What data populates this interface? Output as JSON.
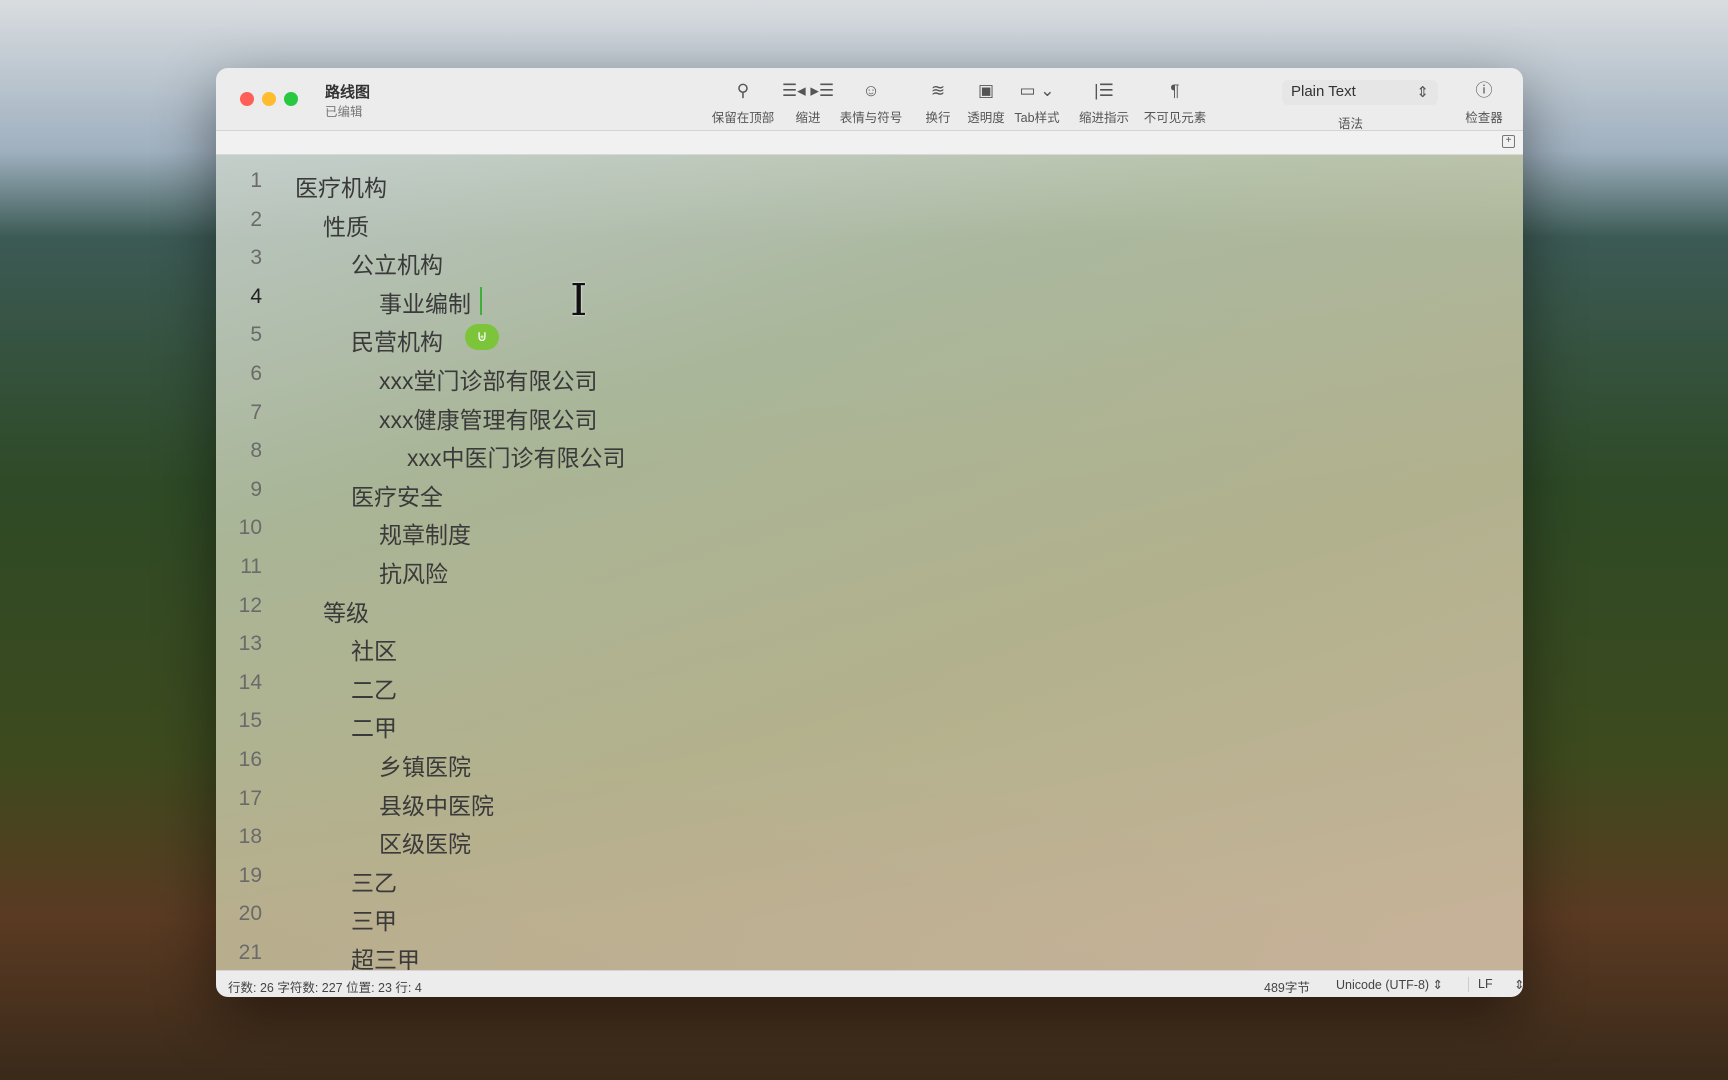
{
  "window": {
    "title": "路线图",
    "subtitle": "已编辑"
  },
  "toolbar": [
    {
      "label": "保留在顶部",
      "icon": "pin-icon",
      "glyph": "⚲"
    },
    {
      "label": "缩进",
      "icon": "indent-icon",
      "glyph": "☰◂ ▸☰"
    },
    {
      "label": "表情与符号",
      "icon": "emoji-icon",
      "glyph": "☺"
    },
    {
      "label": "换行",
      "icon": "wrap-icon",
      "glyph": "≋"
    },
    {
      "label": "透明度",
      "icon": "opacity-icon",
      "glyph": "▣"
    },
    {
      "label": "Tab样式",
      "icon": "tab-style-icon",
      "glyph": "▭ ⌄"
    },
    {
      "label": "缩进指示",
      "icon": "indent-guide-icon",
      "glyph": "|☰"
    },
    {
      "label": "不可见元素",
      "icon": "pilcrow-icon",
      "glyph": "¶"
    },
    {
      "label": "检查器",
      "icon": "info-icon",
      "glyph": "ⓘ"
    }
  ],
  "syntax": {
    "label": "语法",
    "value": "Plain Text"
  },
  "lines": [
    {
      "n": "1",
      "indent": 0,
      "text": "医疗机构"
    },
    {
      "n": "2",
      "indent": 1,
      "text": "性质"
    },
    {
      "n": "3",
      "indent": 2,
      "text": "公立机构"
    },
    {
      "n": "4",
      "indent": 3,
      "text": "事业编制"
    },
    {
      "n": "5",
      "indent": 2,
      "text": "民营机构"
    },
    {
      "n": "6",
      "indent": 3,
      "text": "xxx堂门诊部有限公司"
    },
    {
      "n": "7",
      "indent": 3,
      "text": "xxx健康管理有限公司"
    },
    {
      "n": "8",
      "indent": 4,
      "text": "xxx中医门诊有限公司"
    },
    {
      "n": "9",
      "indent": 2,
      "text": "医疗安全"
    },
    {
      "n": "10",
      "indent": 3,
      "text": "规章制度"
    },
    {
      "n": "11",
      "indent": 3,
      "text": "抗风险"
    },
    {
      "n": "12",
      "indent": 1,
      "text": "等级"
    },
    {
      "n": "13",
      "indent": 2,
      "text": "社区"
    },
    {
      "n": "14",
      "indent": 2,
      "text": "二乙"
    },
    {
      "n": "15",
      "indent": 2,
      "text": "二甲"
    },
    {
      "n": "16",
      "indent": 3,
      "text": "乡镇医院"
    },
    {
      "n": "17",
      "indent": 3,
      "text": "县级中医院"
    },
    {
      "n": "18",
      "indent": 3,
      "text": "区级医院"
    },
    {
      "n": "19",
      "indent": 2,
      "text": "三乙"
    },
    {
      "n": "20",
      "indent": 2,
      "text": "三甲"
    },
    {
      "n": "21",
      "indent": 2,
      "text": "超三甲"
    }
  ],
  "current_line": "4",
  "status": {
    "left": "行数: 26  字符数: 227  位置: 23  行: 4",
    "bytes": "489字节",
    "encoding": "Unicode (UTF-8)",
    "line_ending": "LF"
  },
  "colors": {
    "close": "#ff5f57",
    "minimize": "#febc2e",
    "zoom": "#28c840",
    "caret": "#3fae3a",
    "ime_badge": "#7cc43a"
  }
}
